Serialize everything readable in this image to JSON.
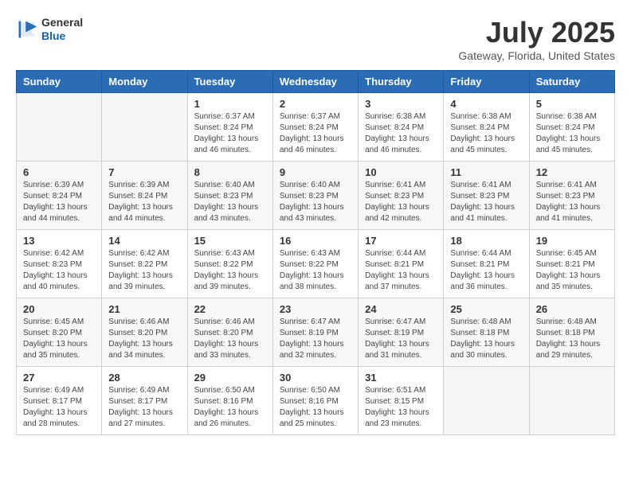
{
  "header": {
    "logo_general": "General",
    "logo_blue": "Blue",
    "month": "July 2025",
    "location": "Gateway, Florida, United States"
  },
  "weekdays": [
    "Sunday",
    "Monday",
    "Tuesday",
    "Wednesday",
    "Thursday",
    "Friday",
    "Saturday"
  ],
  "weeks": [
    [
      {
        "day": "",
        "empty": true
      },
      {
        "day": "",
        "empty": true
      },
      {
        "day": "1",
        "sunrise": "6:37 AM",
        "sunset": "8:24 PM",
        "daylight": "13 hours and 46 minutes."
      },
      {
        "day": "2",
        "sunrise": "6:37 AM",
        "sunset": "8:24 PM",
        "daylight": "13 hours and 46 minutes."
      },
      {
        "day": "3",
        "sunrise": "6:38 AM",
        "sunset": "8:24 PM",
        "daylight": "13 hours and 46 minutes."
      },
      {
        "day": "4",
        "sunrise": "6:38 AM",
        "sunset": "8:24 PM",
        "daylight": "13 hours and 45 minutes."
      },
      {
        "day": "5",
        "sunrise": "6:38 AM",
        "sunset": "8:24 PM",
        "daylight": "13 hours and 45 minutes."
      }
    ],
    [
      {
        "day": "6",
        "sunrise": "6:39 AM",
        "sunset": "8:24 PM",
        "daylight": "13 hours and 44 minutes."
      },
      {
        "day": "7",
        "sunrise": "6:39 AM",
        "sunset": "8:24 PM",
        "daylight": "13 hours and 44 minutes."
      },
      {
        "day": "8",
        "sunrise": "6:40 AM",
        "sunset": "8:23 PM",
        "daylight": "13 hours and 43 minutes."
      },
      {
        "day": "9",
        "sunrise": "6:40 AM",
        "sunset": "8:23 PM",
        "daylight": "13 hours and 43 minutes."
      },
      {
        "day": "10",
        "sunrise": "6:41 AM",
        "sunset": "8:23 PM",
        "daylight": "13 hours and 42 minutes."
      },
      {
        "day": "11",
        "sunrise": "6:41 AM",
        "sunset": "8:23 PM",
        "daylight": "13 hours and 41 minutes."
      },
      {
        "day": "12",
        "sunrise": "6:41 AM",
        "sunset": "8:23 PM",
        "daylight": "13 hours and 41 minutes."
      }
    ],
    [
      {
        "day": "13",
        "sunrise": "6:42 AM",
        "sunset": "8:23 PM",
        "daylight": "13 hours and 40 minutes."
      },
      {
        "day": "14",
        "sunrise": "6:42 AM",
        "sunset": "8:22 PM",
        "daylight": "13 hours and 39 minutes."
      },
      {
        "day": "15",
        "sunrise": "6:43 AM",
        "sunset": "8:22 PM",
        "daylight": "13 hours and 39 minutes."
      },
      {
        "day": "16",
        "sunrise": "6:43 AM",
        "sunset": "8:22 PM",
        "daylight": "13 hours and 38 minutes."
      },
      {
        "day": "17",
        "sunrise": "6:44 AM",
        "sunset": "8:21 PM",
        "daylight": "13 hours and 37 minutes."
      },
      {
        "day": "18",
        "sunrise": "6:44 AM",
        "sunset": "8:21 PM",
        "daylight": "13 hours and 36 minutes."
      },
      {
        "day": "19",
        "sunrise": "6:45 AM",
        "sunset": "8:21 PM",
        "daylight": "13 hours and 35 minutes."
      }
    ],
    [
      {
        "day": "20",
        "sunrise": "6:45 AM",
        "sunset": "8:20 PM",
        "daylight": "13 hours and 35 minutes."
      },
      {
        "day": "21",
        "sunrise": "6:46 AM",
        "sunset": "8:20 PM",
        "daylight": "13 hours and 34 minutes."
      },
      {
        "day": "22",
        "sunrise": "6:46 AM",
        "sunset": "8:20 PM",
        "daylight": "13 hours and 33 minutes."
      },
      {
        "day": "23",
        "sunrise": "6:47 AM",
        "sunset": "8:19 PM",
        "daylight": "13 hours and 32 minutes."
      },
      {
        "day": "24",
        "sunrise": "6:47 AM",
        "sunset": "8:19 PM",
        "daylight": "13 hours and 31 minutes."
      },
      {
        "day": "25",
        "sunrise": "6:48 AM",
        "sunset": "8:18 PM",
        "daylight": "13 hours and 30 minutes."
      },
      {
        "day": "26",
        "sunrise": "6:48 AM",
        "sunset": "8:18 PM",
        "daylight": "13 hours and 29 minutes."
      }
    ],
    [
      {
        "day": "27",
        "sunrise": "6:49 AM",
        "sunset": "8:17 PM",
        "daylight": "13 hours and 28 minutes."
      },
      {
        "day": "28",
        "sunrise": "6:49 AM",
        "sunset": "8:17 PM",
        "daylight": "13 hours and 27 minutes."
      },
      {
        "day": "29",
        "sunrise": "6:50 AM",
        "sunset": "8:16 PM",
        "daylight": "13 hours and 26 minutes."
      },
      {
        "day": "30",
        "sunrise": "6:50 AM",
        "sunset": "8:16 PM",
        "daylight": "13 hours and 25 minutes."
      },
      {
        "day": "31",
        "sunrise": "6:51 AM",
        "sunset": "8:15 PM",
        "daylight": "13 hours and 23 minutes."
      },
      {
        "day": "",
        "empty": true
      },
      {
        "day": "",
        "empty": true
      }
    ]
  ],
  "labels": {
    "sunrise": "Sunrise:",
    "sunset": "Sunset:",
    "daylight": "Daylight:"
  }
}
